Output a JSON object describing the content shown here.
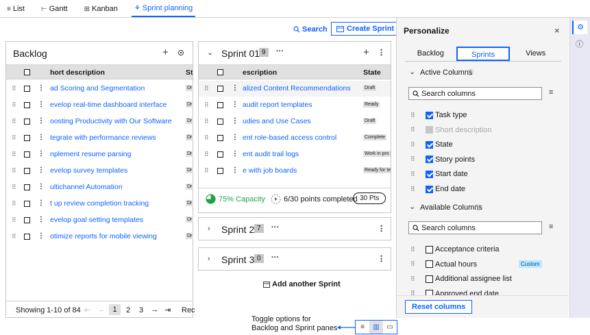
{
  "tabs": [
    {
      "icon": "≡",
      "label": "List"
    },
    {
      "icon": "⊢",
      "label": "Gantt"
    },
    {
      "icon": "⊞",
      "label": "Kanban"
    },
    {
      "icon": "⚘",
      "label": "Sprint planning"
    }
  ],
  "actions": {
    "search": "Search",
    "create": "Create Sprint"
  },
  "backlog": {
    "title": "Backlog",
    "col_desc": "hort description",
    "col_state": "Sta",
    "rows": [
      {
        "d": "ad Scoring and Segmentation",
        "s": "Dr"
      },
      {
        "d": "evelop real-time dashboard interface",
        "s": "Dr"
      },
      {
        "d": "oosting Productivity with Our Software",
        "s": "Dr"
      },
      {
        "d": "tegrate with performance reviews",
        "s": "Dr"
      },
      {
        "d": "nplement resume parsing",
        "s": "Dr"
      },
      {
        "d": "evelop survey templates",
        "s": "Dr"
      },
      {
        "d": "ultichannel Automation",
        "s": "Dr"
      },
      {
        "d": "t up review completion tracking",
        "s": "Dr"
      },
      {
        "d": "evelop goal setting templates",
        "s": "Dr"
      },
      {
        "d": "otimize reports for mobile viewing",
        "s": "Dr"
      }
    ],
    "pager": {
      "showing": "Showing 1-10 of 84",
      "p1": "1",
      "p2": "2",
      "p3": "3",
      "rec": "Rec"
    }
  },
  "sprint1": {
    "title": "Sprint 01",
    "count": "9",
    "col_desc": "escription",
    "col_state": "State",
    "rows": [
      {
        "d": "alized Content Recommendations",
        "s": "Draft"
      },
      {
        "d": "audit report templates",
        "s": "Ready"
      },
      {
        "d": "udies and Use Cases",
        "s": "Draft"
      },
      {
        "d": "ent role-based access control",
        "s": "Complete"
      },
      {
        "d": "ent audit trail logs",
        "s": "Work in pro"
      },
      {
        "d": "e with job boards",
        "s": "Ready for te"
      }
    ],
    "capacity": "75% Capacity",
    "points": "6/30 points completed",
    "pts": "30 Pts"
  },
  "sprint2": {
    "title": "Sprint 2",
    "count": "7"
  },
  "sprint3": {
    "title": "Sprint 3",
    "count": "0"
  },
  "add_sprint": "Add another Sprint",
  "personalize": {
    "title": "Personalize",
    "tabs": [
      "Backlog",
      "Sprints",
      "Views"
    ],
    "active_title": "Active Columns",
    "search_ph": "Search columns",
    "active": [
      {
        "l": "Task type",
        "st": "on"
      },
      {
        "l": "Short description",
        "st": "dis"
      },
      {
        "l": "State",
        "st": "on"
      },
      {
        "l": "Story points",
        "st": "on"
      },
      {
        "l": "Start date",
        "st": "on"
      },
      {
        "l": "End date",
        "st": "on"
      }
    ],
    "avail_title": "Available Columns",
    "available": [
      {
        "l": "Acceptance criteria",
        "tag": ""
      },
      {
        "l": "Actual hours",
        "tag": "Custom"
      },
      {
        "l": "Additional assignee list",
        "tag": ""
      },
      {
        "l": "Approved end date",
        "tag": ""
      }
    ],
    "reset": "Reset columns"
  },
  "annotation": {
    "line1": "Toggle options for",
    "line2": "Backlog and Sprint panes"
  },
  "colors": {
    "accent": "#0f62fe",
    "capacity": "#24a148"
  }
}
